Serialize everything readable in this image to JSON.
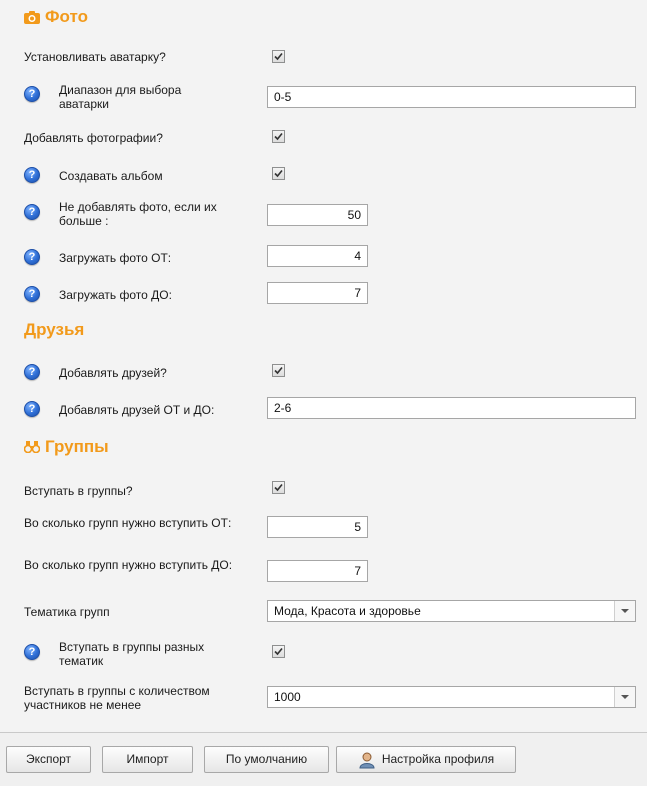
{
  "sections": {
    "photo": {
      "title": "Фото"
    },
    "friends": {
      "title": "Друзья"
    },
    "groups": {
      "title": "Группы"
    }
  },
  "photo": {
    "set_avatar": {
      "label": "Установливать аватарку?",
      "checked": true
    },
    "avatar_range": {
      "label": "Диапазон для выбора аватарки",
      "value": "0-5"
    },
    "add_photos": {
      "label": "Добавлять фотографии?",
      "checked": true
    },
    "create_album": {
      "label": "Создавать альбом",
      "checked": true
    },
    "skip_if_more": {
      "label": "Не добавлять фото, если их больше :",
      "value": "50"
    },
    "upload_from": {
      "label": "Загружать фото ОТ:",
      "value": "4"
    },
    "upload_to": {
      "label": "Загружать фото ДО:",
      "value": "7"
    }
  },
  "friends": {
    "add_friends": {
      "label": "Добавлять друзей?",
      "checked": true
    },
    "friends_range": {
      "label": "Добавлять друзей ОТ и ДО:",
      "value": "2-6"
    }
  },
  "groups": {
    "join_groups": {
      "label": "Вступать в группы?",
      "checked": true
    },
    "join_from": {
      "label": "Во сколько групп нужно вступить ОТ:",
      "value": "5"
    },
    "join_to": {
      "label": "Во сколько групп нужно вступить ДО:",
      "value": "7"
    },
    "topic": {
      "label": "Тематика групп",
      "value": "Мода, Красота и здоровье"
    },
    "diff_topics": {
      "label": "Вступать в группы разных тематик",
      "checked": true
    },
    "min_members": {
      "label": "Вступать в группы с количеством участников не менее",
      "value": "1000"
    }
  },
  "buttons": {
    "export": "Экспорт",
    "import": "Импорт",
    "defaults": "По умолчанию",
    "profile_settings": "Настройка профиля"
  },
  "colors": {
    "section_title": "#f29a1b",
    "help_icon": "#2f6fd6"
  },
  "icons": {
    "photo": "camera-icon",
    "groups": "binoculars-icon",
    "help": "question-icon",
    "profile": "user-icon"
  }
}
